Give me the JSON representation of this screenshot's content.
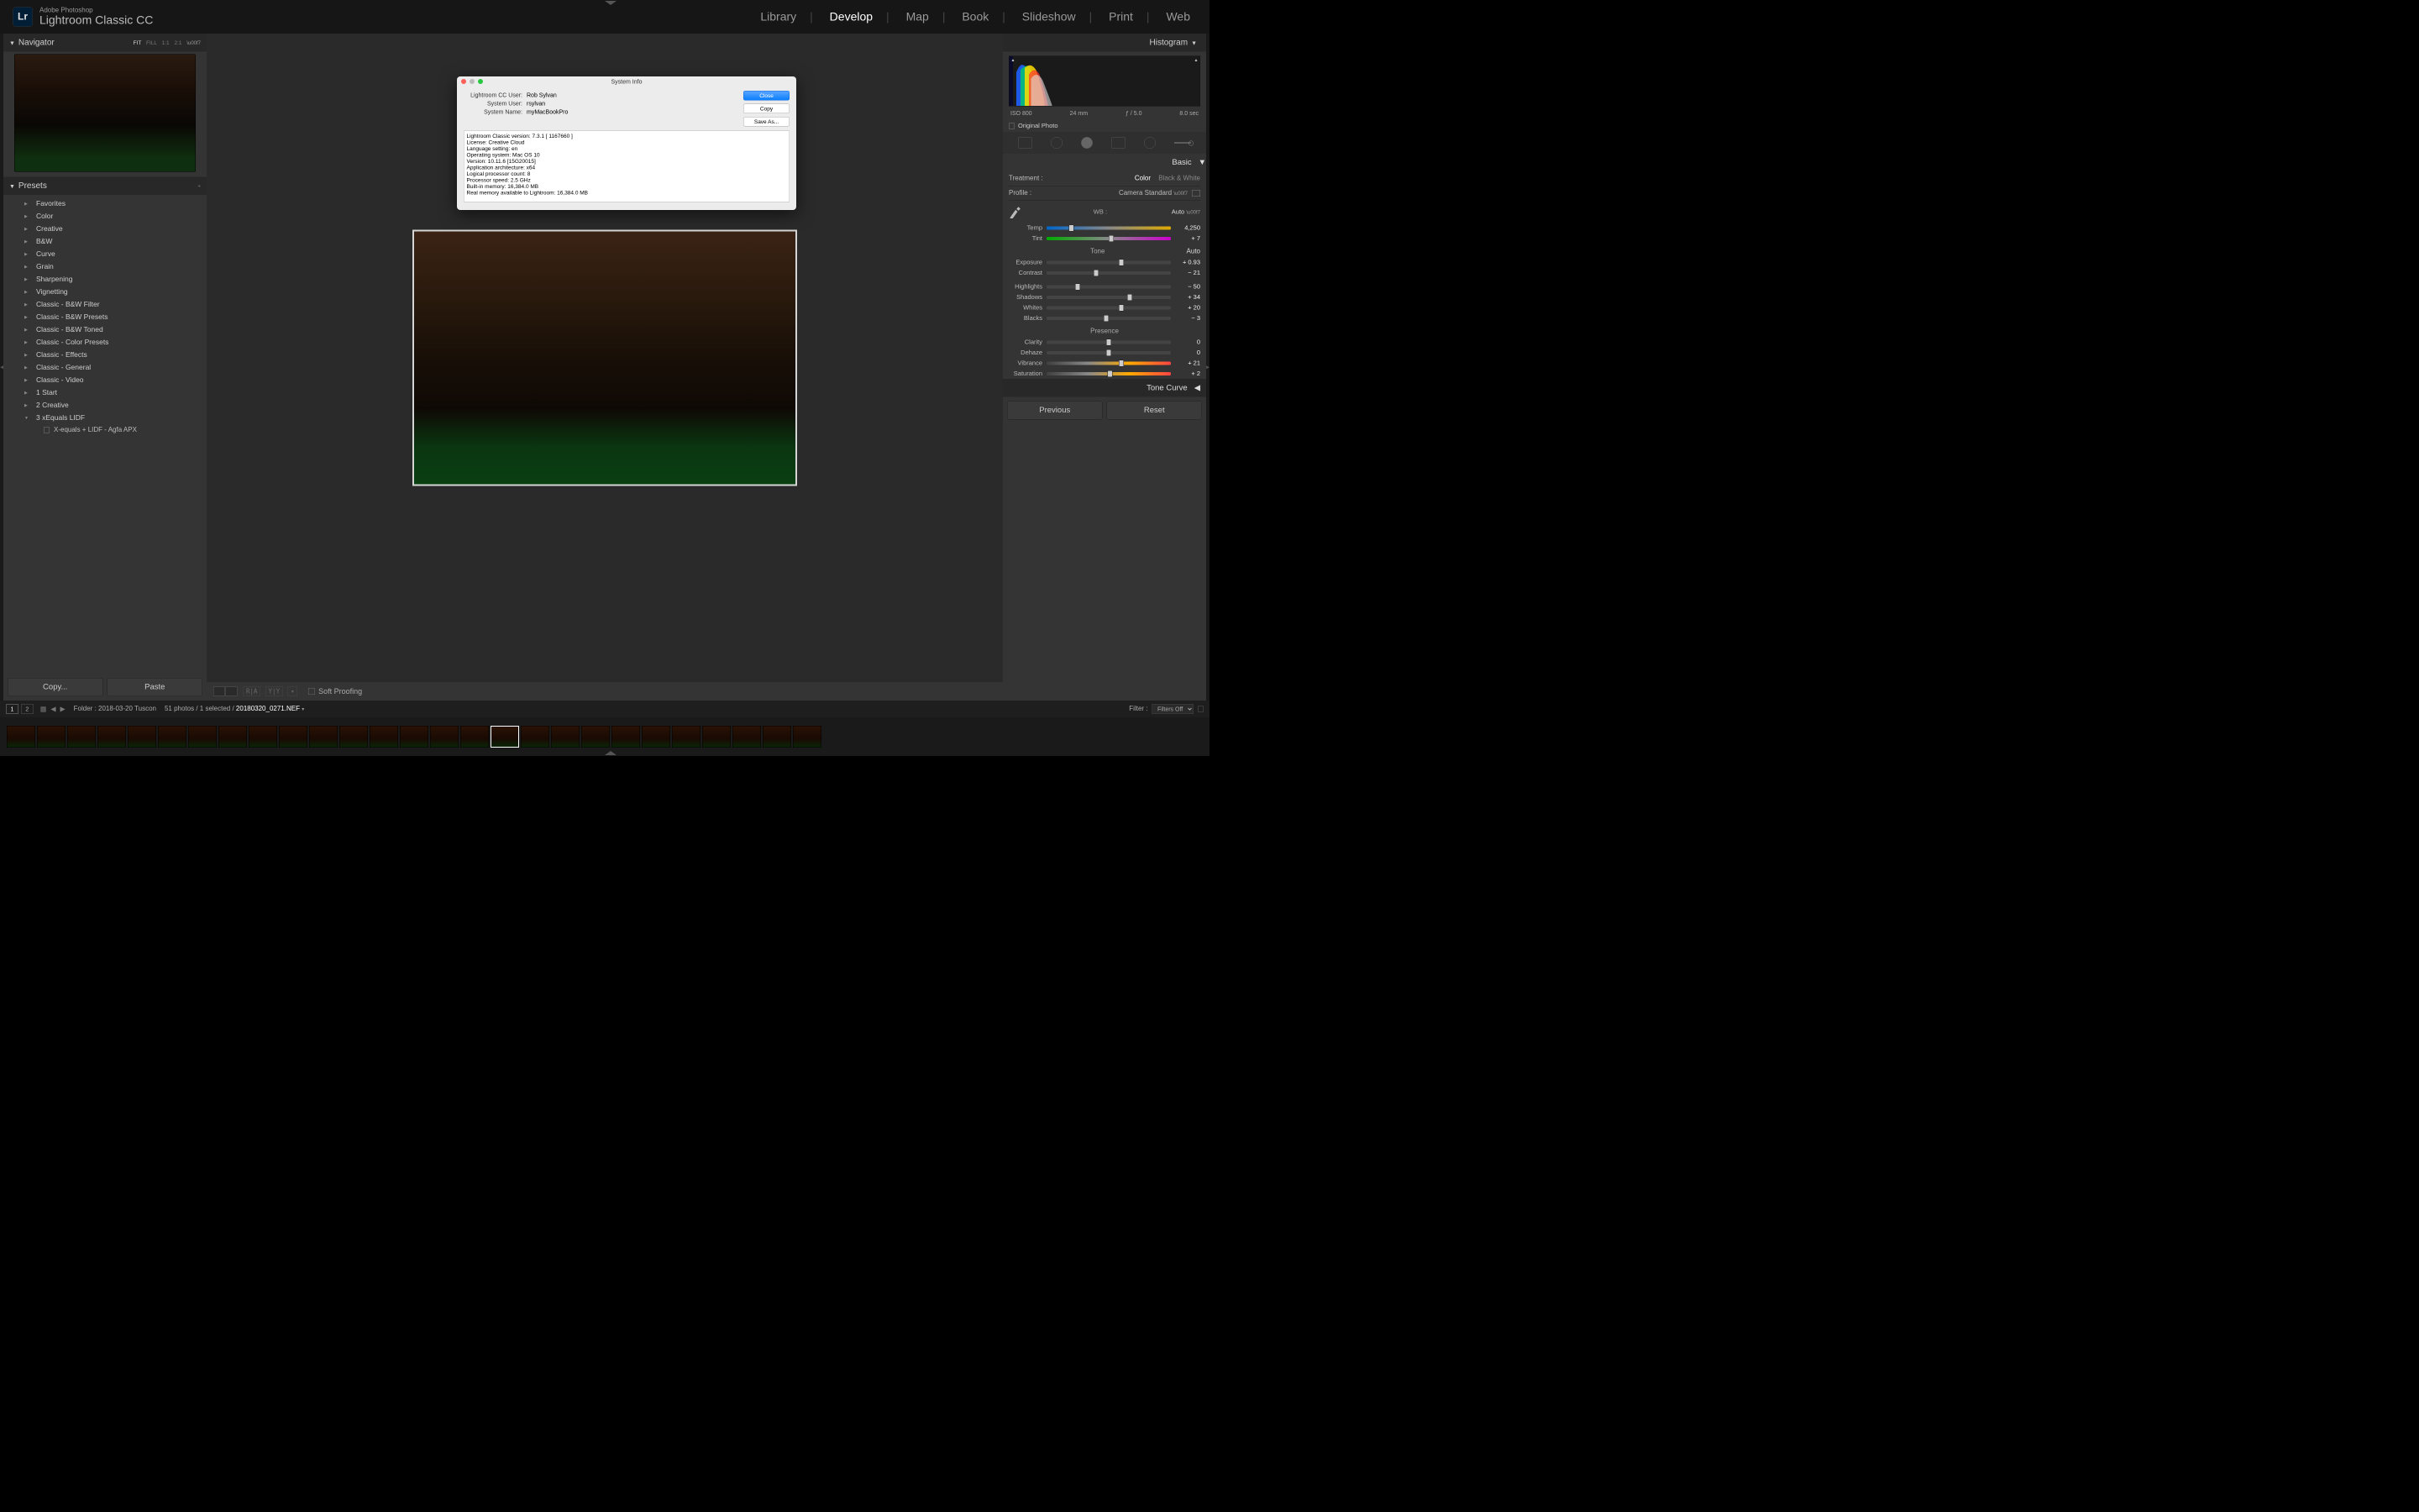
{
  "app": {
    "brand_line1": "Adobe Photoshop",
    "brand_line2": "Lightroom Classic CC",
    "logo": "Lr"
  },
  "modules": [
    "Library",
    "Develop",
    "Map",
    "Book",
    "Slideshow",
    "Print",
    "Web"
  ],
  "modules_active": "Develop",
  "navigator": {
    "title": "Navigator",
    "modes": [
      "FIT",
      "FILL",
      "1:1",
      "2:1"
    ],
    "mode_active": "FIT"
  },
  "presets": {
    "title": "Presets",
    "items": [
      "Favorites",
      "Color",
      "Creative",
      "B&W",
      "Curve",
      "Grain",
      "Sharpening",
      "Vignetting",
      "Classic - B&W Filter",
      "Classic - B&W Presets",
      "Classic - B&W Toned",
      "Classic - Color Presets",
      "Classic - Effects",
      "Classic - General",
      "Classic - Video",
      "1 Start",
      "2 Creative"
    ],
    "open_item": "3 xEquals LIDF",
    "child_item": "X-equals + LIDF - Agfa APX"
  },
  "left_buttons": {
    "copy": "Copy...",
    "paste": "Paste"
  },
  "center_toolbar": {
    "soft_proofing": "Soft Proofing"
  },
  "histogram": {
    "title": "Histogram",
    "meta": {
      "iso": "ISO 800",
      "focal": "24 mm",
      "aperture": "ƒ / 5.0",
      "shutter": "8.0 sec"
    },
    "original_photo": "Original Photo"
  },
  "basic": {
    "title": "Basic",
    "treatment_label": "Treatment :",
    "treatment_opts": [
      "Color",
      "Black & White"
    ],
    "treatment_active": "Color",
    "profile_label": "Profile :",
    "profile_value": "Camera Standard",
    "wb_label": "WB :",
    "wb_mode": "Auto",
    "temp": {
      "label": "Temp",
      "value": "4,250",
      "pos": 20
    },
    "tint": {
      "label": "Tint",
      "value": "+ 7",
      "pos": 52
    },
    "tone": {
      "title": "Tone",
      "auto": "Auto"
    },
    "exposure": {
      "label": "Exposure",
      "value": "+ 0.93",
      "pos": 60
    },
    "contrast": {
      "label": "Contrast",
      "value": "− 21",
      "pos": 40
    },
    "highlights": {
      "label": "Highlights",
      "value": "− 50",
      "pos": 25
    },
    "shadows": {
      "label": "Shadows",
      "value": "+ 34",
      "pos": 67
    },
    "whites": {
      "label": "Whites",
      "value": "+ 20",
      "pos": 60
    },
    "blacks": {
      "label": "Blacks",
      "value": "− 3",
      "pos": 48
    },
    "presence": {
      "title": "Presence"
    },
    "clarity": {
      "label": "Clarity",
      "value": "0",
      "pos": 50
    },
    "dehaze": {
      "label": "Dehaze",
      "value": "0",
      "pos": 50
    },
    "vibrance": {
      "label": "Vibrance",
      "value": "+ 21",
      "pos": 60
    },
    "saturation": {
      "label": "Saturation",
      "value": "+ 2",
      "pos": 51
    },
    "tone_curve": "Tone Curve"
  },
  "right_buttons": {
    "previous": "Previous",
    "reset": "Reset"
  },
  "statusbar": {
    "pages": [
      "1",
      "2"
    ],
    "page_active": "1",
    "folder_label": "Folder :",
    "folder_name": "2018-03-20 Tuscon",
    "count": "51 photos / 1 selected /",
    "filename": "20180320_0271.NEF",
    "filter_label": "Filter :",
    "filter_value": "Filters Off"
  },
  "filmstrip": {
    "count": 27,
    "selected_index": 16
  },
  "dialog": {
    "title": "System Info",
    "rows": [
      {
        "k": "Lightroom CC User:",
        "v": "Rob Sylvan"
      },
      {
        "k": "System User:",
        "v": "rsylvan"
      },
      {
        "k": "System Name:",
        "v": "myMacBookPro"
      }
    ],
    "buttons": {
      "close": "Close",
      "copy": "Copy",
      "save_as": "Save As..."
    },
    "text": "Lightroom Classic version: 7.3.1 [ 1167660 ]\nLicense: Creative Cloud\nLanguage setting: en\nOperating system: Mac OS 10\nVersion: 10.11.6 [15G20015]\nApplication architecture: x64\nLogical processor count: 8\nProcessor speed: 2.5 GHz\nBuilt-in memory: 16,384.0 MB\nReal memory available to Lightroom: 16,384.0 MB"
  }
}
